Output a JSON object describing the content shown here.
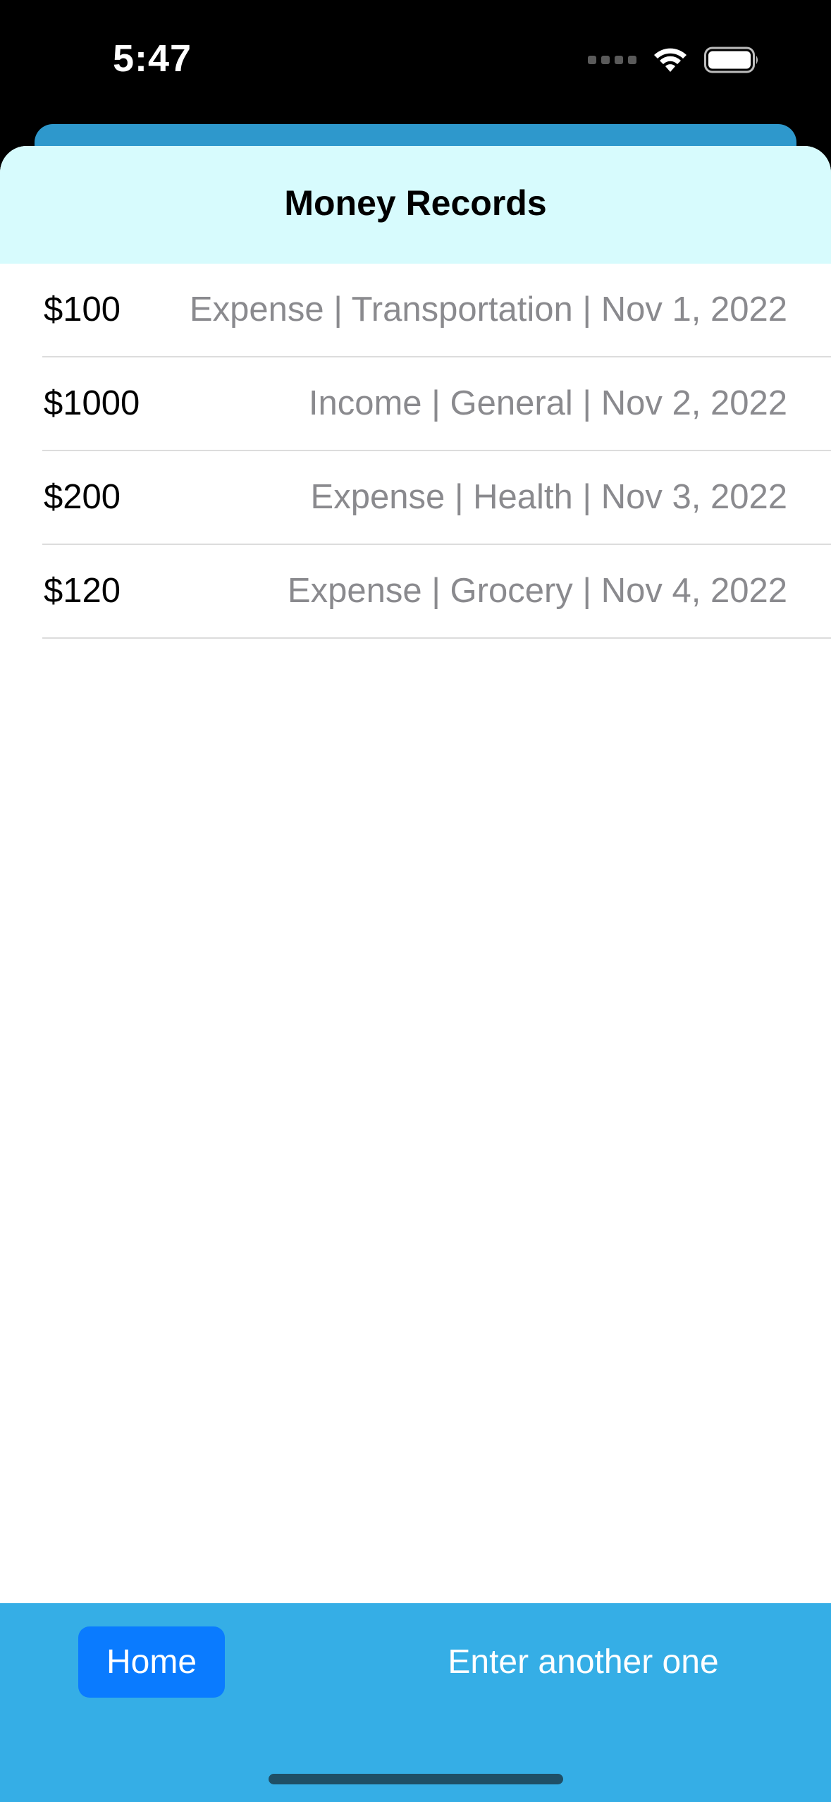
{
  "status_bar": {
    "time": "5:47",
    "wifi_icon": "wifi-icon",
    "battery_icon": "battery-icon",
    "signal_icon": "signal-dots-icon"
  },
  "header": {
    "title": "Money Records"
  },
  "records": [
    {
      "amount": "$100",
      "detail": "Expense | Transportation | Nov 1, 2022"
    },
    {
      "amount": "$1000",
      "detail": "Income | General | Nov 2, 2022"
    },
    {
      "amount": "$200",
      "detail": "Expense | Health | Nov 3, 2022"
    },
    {
      "amount": "$120",
      "detail": "Expense | Grocery | Nov 4, 2022"
    }
  ],
  "toolbar": {
    "home_label": "Home",
    "enter_label": "Enter another one"
  },
  "colors": {
    "header_bg": "#d7fbfd",
    "toolbar_bg": "#35aee6",
    "home_button_bg": "#0a7bff",
    "detail_text": "#8a8a8e",
    "sheet_back": "#2e98cc"
  }
}
